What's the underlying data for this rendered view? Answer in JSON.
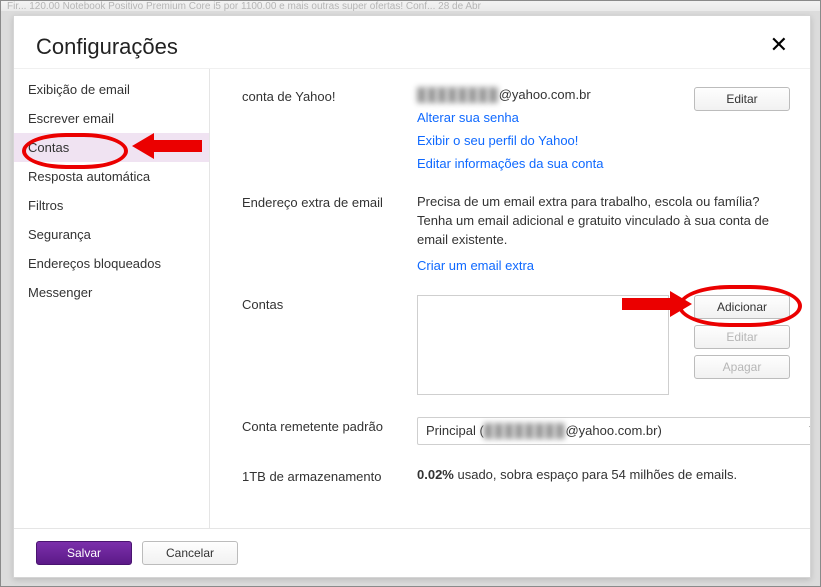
{
  "backgroundFaded": "Fir... 120.00 Notebook Positivo Premium Core i5 por 1100.00 e mais outras super ofertas! Conf...                       28 de Abr",
  "header": {
    "title": "Configurações"
  },
  "sidebar": {
    "items": [
      {
        "label": "Exibição de email"
      },
      {
        "label": "Escrever email"
      },
      {
        "label": "Contas"
      },
      {
        "label": "Resposta automática"
      },
      {
        "label": "Filtros"
      },
      {
        "label": "Segurança"
      },
      {
        "label": "Endereços bloqueados"
      },
      {
        "label": "Messenger"
      }
    ],
    "activeIndex": 2
  },
  "section": {
    "yahooAccount": {
      "label": "conta de Yahoo!",
      "emailHiddenPrefix": "████████",
      "emailDomain": "@yahoo.com.br",
      "editBtn": "Editar",
      "linkChangePassword": "Alterar sua senha",
      "linkViewProfile": "Exibir o seu perfil do Yahoo!",
      "linkEditInfo": "Editar informações da sua conta"
    },
    "extraEmail": {
      "label": "Endereço extra de email",
      "desc": "Precisa de um email extra para trabalho, escola ou família? Tenha um email adicional e gratuito vinculado à sua conta de email existente.",
      "linkCreate": "Criar um email extra"
    },
    "accounts": {
      "label": "Contas",
      "btnAdd": "Adicionar",
      "btnEdit": "Editar",
      "btnDelete": "Apagar"
    },
    "defaultSender": {
      "label": "Conta remetente padrão",
      "selectPrefix": "Principal (",
      "selectHidden": "████████",
      "selectSuffix": "@yahoo.com.br)"
    },
    "storage": {
      "label": "1TB de armazenamento",
      "percent": "0.02%",
      "rest": " usado, sobra espaço para 54 milhões de emails."
    }
  },
  "footer": {
    "save": "Salvar",
    "cancel": "Cancelar"
  }
}
